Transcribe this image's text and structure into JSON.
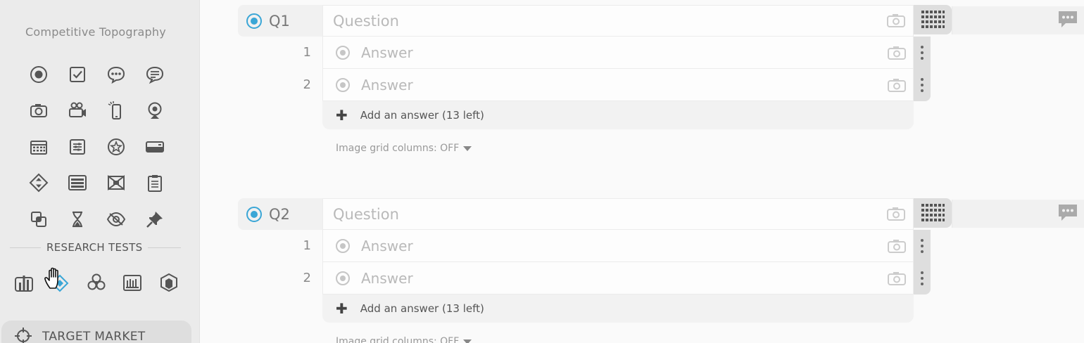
{
  "sidebar": {
    "title": "Competitive Topography",
    "question_icons": [
      "radio-icon",
      "checkbox-icon",
      "chat-bubble-icon",
      "speech-bubble-icon",
      "camera-icon",
      "video-camera-icon",
      "mobile-phone-icon",
      "webcam-icon",
      "calendar-icon",
      "sliders-icon",
      "star-badge-icon",
      "card-icon",
      "priority-arrows-icon",
      "list-icon",
      "bowtie-icon",
      "clipboard-icon",
      "shape-overlap-icon",
      "hourglass-icon",
      "eye-icon",
      "pin-icon"
    ],
    "research_tests_label": "RESEARCH TESTS",
    "research_icons": [
      "bar-chart-icon",
      "diamond-icon",
      "cluster-icon",
      "tally-icon",
      "cube-icon"
    ],
    "target_market_label": "TARGET MARKET"
  },
  "questions": [
    {
      "number": "Q1",
      "placeholder": "Question",
      "answers": [
        {
          "num": "1",
          "placeholder": "Answer"
        },
        {
          "num": "2",
          "placeholder": "Answer"
        }
      ],
      "add_answer_label": "Add an answer (13 left)",
      "grid_columns_label": "Image grid columns: OFF"
    },
    {
      "number": "Q2",
      "placeholder": "Question",
      "answers": [
        {
          "num": "1",
          "placeholder": "Answer"
        },
        {
          "num": "2",
          "placeholder": "Answer"
        }
      ],
      "add_answer_label": "Add an answer (13 left)",
      "grid_columns_label": "Image grid columns: OFF"
    }
  ],
  "colors": {
    "accent_blue": "#3aa6d6",
    "sidebar_bg": "#ebebeb",
    "canvas_bg": "#fafafa"
  }
}
